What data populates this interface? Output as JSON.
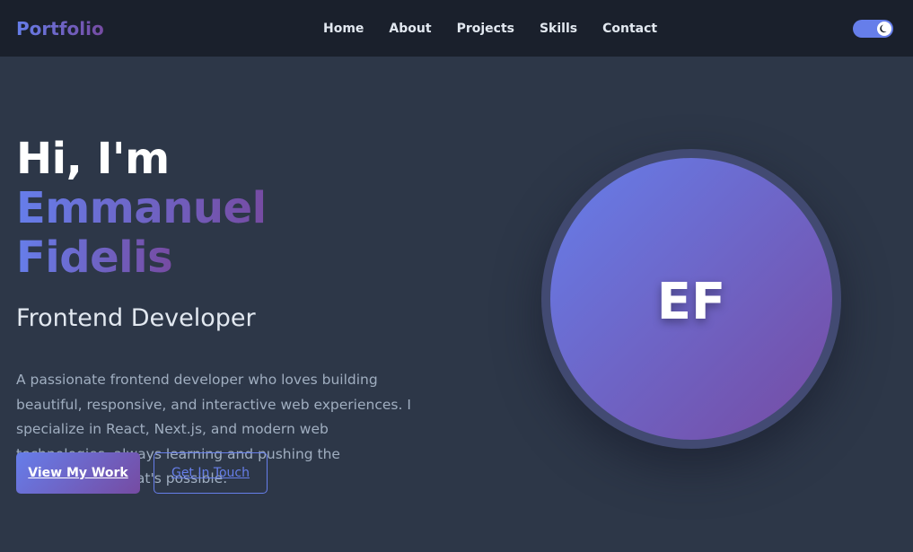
{
  "nav": {
    "logo": "Portfolio",
    "links": [
      "Home",
      "About",
      "Projects",
      "Skills",
      "Contact"
    ],
    "theme_toggle_icon": "moon-icon"
  },
  "hero": {
    "greeting": "Hi, I'm ",
    "first_name": "Emmanuel",
    "last_name": "Fidelis",
    "subtitle": "Frontend Developer",
    "description": "A passionate frontend developer who loves building beautiful, responsive, and interactive web experiences. I specialize in React, Next.js, and modern web technologies, always learning and pushing the boundaries of what's possible.",
    "primary_button": "View My Work",
    "secondary_button": "Get In Touch",
    "avatar_initials": "EF"
  },
  "colors": {
    "background": "#2d3748",
    "navbar": "#1a202c",
    "accent_start": "#667eea",
    "accent_end": "#764ba2",
    "text": "#e2e8f0",
    "muted_text": "#a0aec0"
  }
}
